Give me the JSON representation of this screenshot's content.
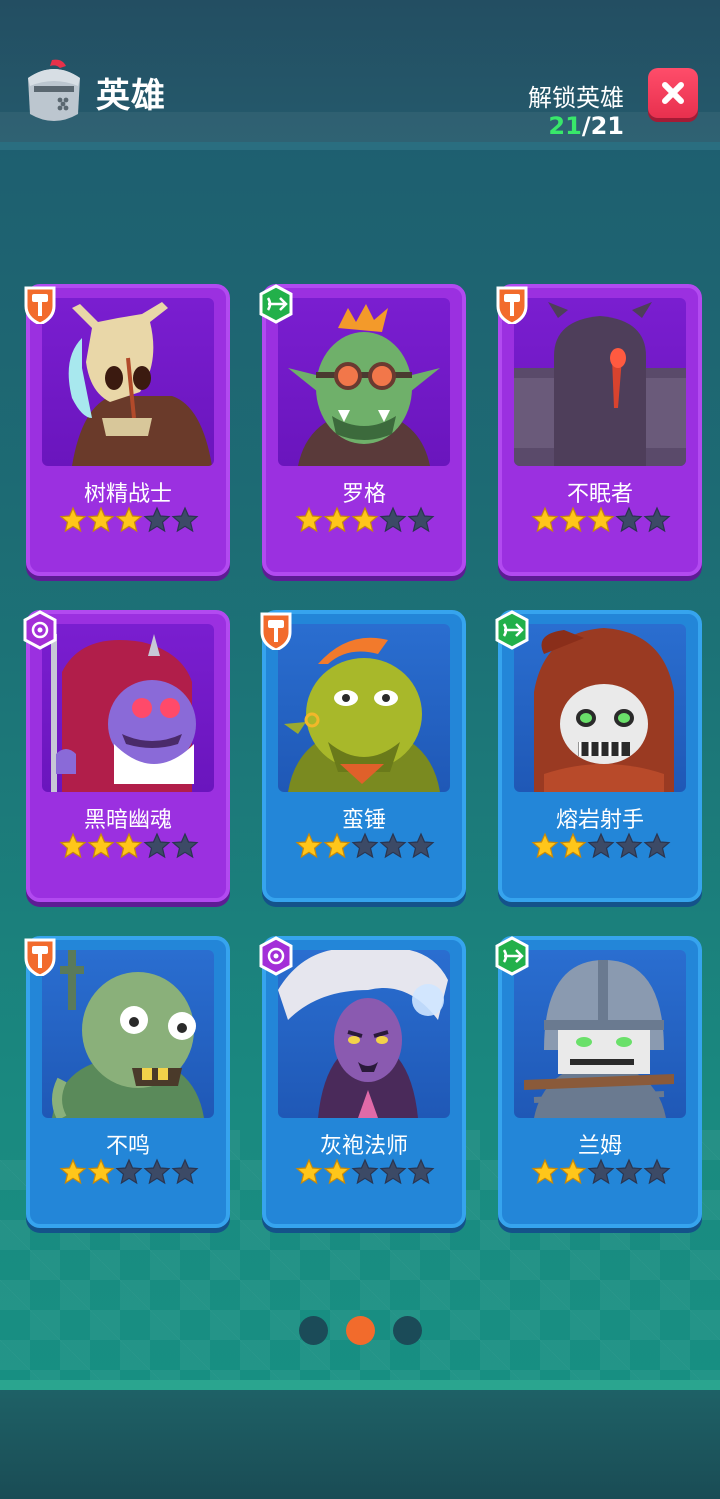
{
  "header": {
    "title": "英雄",
    "unlock_label": "解锁英雄",
    "unlock_current": "21",
    "unlock_total": "/21",
    "close_icon": "close-icon"
  },
  "heroes": [
    {
      "name": "树精战士",
      "stars": 3,
      "max_stars": 5,
      "rarity": "purple",
      "class_icon": "hammer-icon"
    },
    {
      "name": "罗格",
      "stars": 3,
      "max_stars": 5,
      "rarity": "purple",
      "class_icon": "bow-icon"
    },
    {
      "name": "不眠者",
      "stars": 3,
      "max_stars": 5,
      "rarity": "purple",
      "class_icon": "hammer-icon"
    },
    {
      "name": "黑暗幽魂",
      "stars": 3,
      "max_stars": 5,
      "rarity": "purple",
      "class_icon": "magic-icon"
    },
    {
      "name": "蛮锤",
      "stars": 2,
      "max_stars": 5,
      "rarity": "blue",
      "class_icon": "hammer-icon"
    },
    {
      "name": "熔岩射手",
      "stars": 2,
      "max_stars": 5,
      "rarity": "blue",
      "class_icon": "bow-icon"
    },
    {
      "name": "不鸣",
      "stars": 2,
      "max_stars": 5,
      "rarity": "blue",
      "class_icon": "hammer-icon"
    },
    {
      "name": "灰袍法师",
      "stars": 2,
      "max_stars": 5,
      "rarity": "blue",
      "class_icon": "magic-icon"
    },
    {
      "name": "兰姆",
      "stars": 2,
      "max_stars": 5,
      "rarity": "blue",
      "class_icon": "bow-icon"
    }
  ],
  "pagination": {
    "pages": 3,
    "current": 2
  },
  "colors": {
    "purple_card": "#9b30e0",
    "blue_card": "#2386d8",
    "star_filled": "#ffc61a",
    "star_empty": "#3c4a66",
    "hammer_badge": "#f26b2c",
    "bow_badge": "#22b04a",
    "magic_badge": "#a32fd8",
    "unlock_count": "#38e86a",
    "close_button": "#ff4d6a",
    "active_dot": "#f26b2c"
  }
}
